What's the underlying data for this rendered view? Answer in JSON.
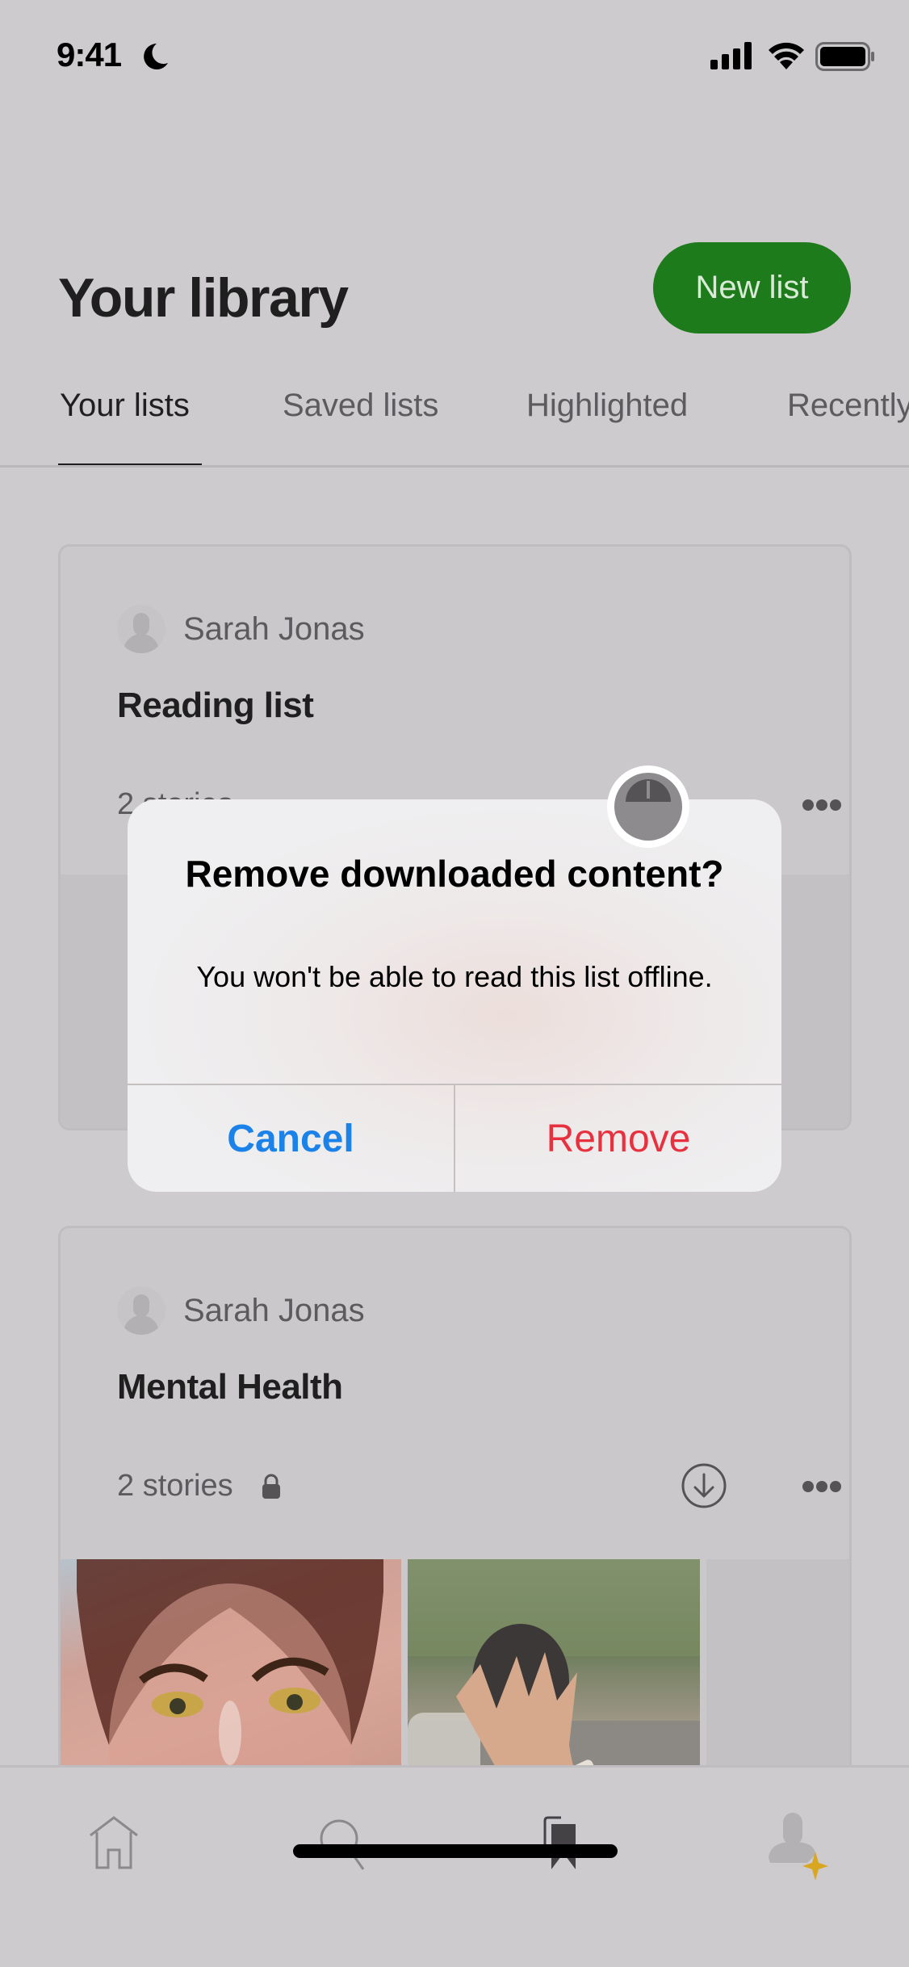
{
  "status_bar": {
    "time": "9:41",
    "focus_icon": "moon-icon",
    "signal_icon": "cellular-signal-icon",
    "wifi_icon": "wifi-icon",
    "battery_icon": "battery-icon"
  },
  "header": {
    "title": "Your library",
    "new_list_label": "New list",
    "accent_color": "#1e7b1c"
  },
  "tabs": [
    {
      "label": "Your lists",
      "active": true
    },
    {
      "label": "Saved lists",
      "active": false
    },
    {
      "label": "Highlighted",
      "active": false
    },
    {
      "label": "Recently",
      "active": false
    }
  ],
  "lists": [
    {
      "author": "Sarah Jonas",
      "title": "Reading list",
      "story_count": "2 stories",
      "private": false
    },
    {
      "author": "Sarah Jonas",
      "title": "Mental Health",
      "story_count": "2 stories",
      "private": true,
      "thumbnails": [
        "woman-face-portrait",
        "hand-waving-street"
      ]
    }
  ],
  "dialog": {
    "title": "Remove downloaded content?",
    "message": "You won't be able to read this list offline.",
    "cancel_label": "Cancel",
    "remove_label": "Remove",
    "cancel_color": "#1a82e8",
    "remove_color": "#e8313f"
  },
  "bottom_nav": [
    {
      "icon": "home-icon",
      "active": false
    },
    {
      "icon": "search-icon",
      "active": false
    },
    {
      "icon": "bookmarks-icon",
      "active": true
    },
    {
      "icon": "profile-icon",
      "active": false
    }
  ]
}
